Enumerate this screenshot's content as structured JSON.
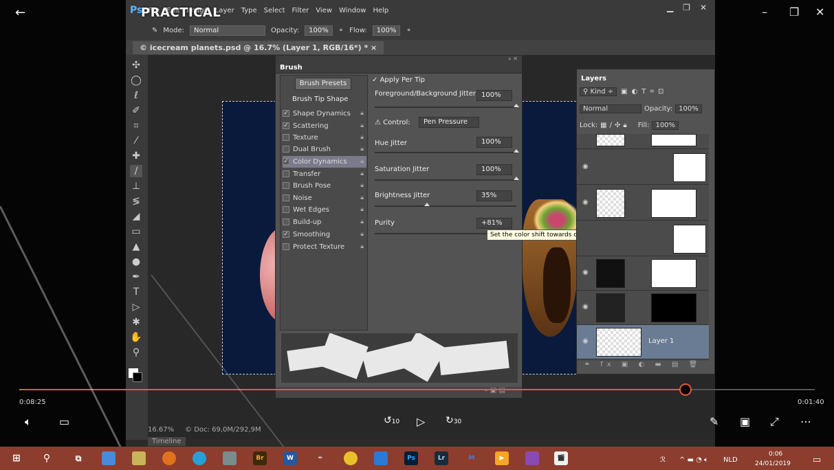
{
  "ps": {
    "logo": "Ps",
    "watermark": "PRACTICAL",
    "menu": [
      "File",
      "Edit",
      "Image",
      "Layer",
      "Type",
      "Select",
      "Filter",
      "View",
      "Window",
      "Help"
    ],
    "options": {
      "mode_label": "Mode:",
      "mode_value": "Normal",
      "opacity_label": "Opacity:",
      "opacity_value": "100%",
      "flow_label": "Flow:",
      "flow_value": "100%"
    },
    "doc_tab": "© icecream planets.psd @ 16.7% (Layer 1, RGB/16*) * ×",
    "status_zoom": "16.67%",
    "status_doc": "© Doc: 69,0M/292,9M",
    "timeline": "Timeline"
  },
  "brush": {
    "title": "Brush",
    "presets_btn": "Brush Presets",
    "tip_shape": "Brush Tip Shape",
    "options": [
      {
        "label": "Shape Dynamics",
        "checked": true
      },
      {
        "label": "Scattering",
        "checked": true
      },
      {
        "label": "Texture",
        "checked": false
      },
      {
        "label": "Dual Brush",
        "checked": false
      },
      {
        "label": "Color Dynamics",
        "checked": true
      },
      {
        "label": "Transfer",
        "checked": false
      },
      {
        "label": "Brush Pose",
        "checked": false
      },
      {
        "label": "Noise",
        "checked": false
      },
      {
        "label": "Wet Edges",
        "checked": false
      },
      {
        "label": "Build-up",
        "checked": false
      },
      {
        "label": "Smoothing",
        "checked": true
      },
      {
        "label": "Protect Texture",
        "checked": false
      }
    ],
    "apply_per_tip": "Apply Per Tip",
    "fg_bg_label": "Foreground/Background Jitter",
    "fg_bg_value": "100%",
    "control_label": "Control:",
    "control_value": "Pen Pressure",
    "hue_label": "Hue Jitter",
    "hue_value": "100%",
    "sat_label": "Saturation Jitter",
    "sat_value": "100%",
    "bright_label": "Brightness Jitter",
    "bright_value": "35%",
    "purity_label": "Purity",
    "purity_value": "+81%"
  },
  "tooltip": "Set the color shift towards or away from the neutral axis",
  "layers": {
    "title": "Layers",
    "kind": "Kind",
    "blend": "Normal",
    "opacity_label": "Opacity:",
    "opacity_value": "100%",
    "lock_label": "Lock:",
    "fill_label": "Fill:",
    "fill_value": "100%",
    "active_layer": "Layer 1"
  },
  "player": {
    "time_elapsed": "0:08:25",
    "time_remaining": "0:01:40",
    "skip_back": "10",
    "skip_fwd": "30"
  },
  "taskbar": {
    "lang": "NLD",
    "time": "0:06",
    "date": "24/01/2019"
  }
}
